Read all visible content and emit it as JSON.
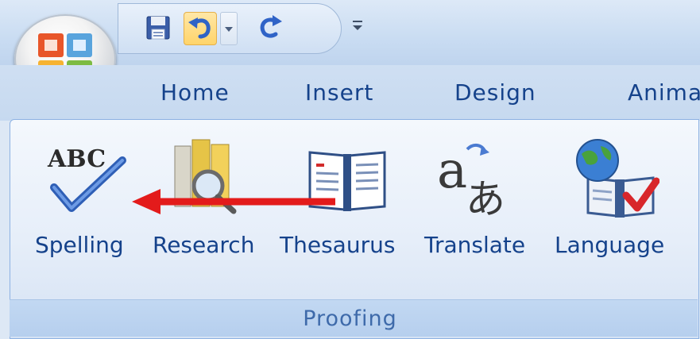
{
  "tabs": [
    {
      "label": "Home"
    },
    {
      "label": "Insert"
    },
    {
      "label": "Design"
    },
    {
      "label": "Anima"
    }
  ],
  "proofing": {
    "group_label": "Proofing",
    "tools": [
      {
        "label": "Spelling",
        "icon": "spelling-abc-check-icon"
      },
      {
        "label": "Research",
        "icon": "research-books-magnifier-icon"
      },
      {
        "label": "Thesaurus",
        "icon": "thesaurus-book-icon"
      },
      {
        "label": "Translate",
        "icon": "translate-a-to-japanese-icon"
      },
      {
        "label": "Language",
        "icon": "language-globe-book-icon"
      }
    ]
  },
  "annotation": {
    "arrow_color": "#e31b1b"
  },
  "colors": {
    "tab_text": "#15428b",
    "ribbon_border": "#8db2e3"
  }
}
